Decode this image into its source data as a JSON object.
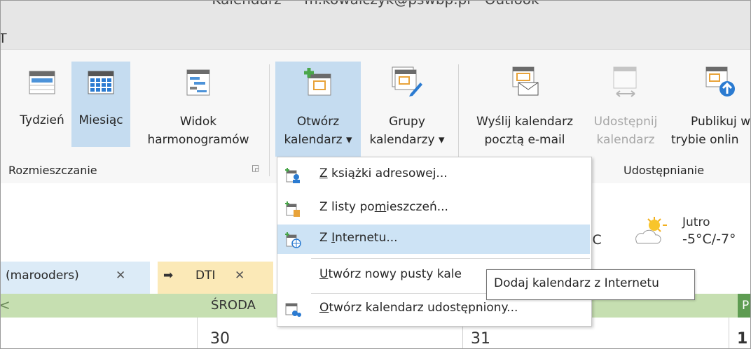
{
  "window": {
    "title": "Kalendarz — m.kowalczyk@pswbp.pl - Outlook",
    "menu_fragment": "T"
  },
  "ribbon": {
    "rozmieszczanie": {
      "tydzien": "Tydzień",
      "miesiac": "Miesiąc",
      "widok_line1": "Widok",
      "widok_line2": "harmonogramów",
      "group_label": "Rozmieszczanie"
    },
    "zarzadzaj": {
      "otworz_line1": "Otwórz",
      "otworz_line2": "kalendarz ▾",
      "grupy_line1": "Grupy",
      "grupy_line2": "kalendarzy ▾"
    },
    "udostepnianie": {
      "wyslij_line1": "Wyślij kalendarz",
      "wyslij_line2": "pocztą e-mail",
      "udostepnij_line1": "Udostępnij",
      "udostepnij_line2": "kalendarz",
      "publikuj_line1": "Publikuj w",
      "publikuj_line2": "trybie onlin",
      "group_label": "Udostępnianie"
    }
  },
  "dropdown": {
    "items": [
      {
        "pre": "",
        "u": "Z",
        "post": " książki adresowej..."
      },
      {
        "pre": "Z listy po",
        "u": "m",
        "post": "ieszczeń..."
      },
      {
        "pre": "Z ",
        "u": "I",
        "post": "nternetu..."
      },
      {
        "pre": "",
        "u": "U",
        "post": "twórz nowy pusty kale"
      },
      {
        "pre": "",
        "u": "O",
        "post": "twórz kalendarz udostępniony..."
      }
    ]
  },
  "tooltip": "Dodaj kalendarz z Internetu",
  "weather": {
    "today_partial": "°C",
    "tomorrow_label": "Jutro",
    "tomorrow_temp": "-5°C/-7°"
  },
  "tabs": [
    {
      "label": "(marooders)",
      "close": "✕"
    },
    {
      "arrow": "➡",
      "label": "DTI",
      "close": "✕"
    }
  ],
  "calendar": {
    "left_arrow": "<",
    "day_header": "ŚRODA",
    "partial_header": "P",
    "day_numbers": [
      "30",
      "31",
      "1"
    ]
  }
}
